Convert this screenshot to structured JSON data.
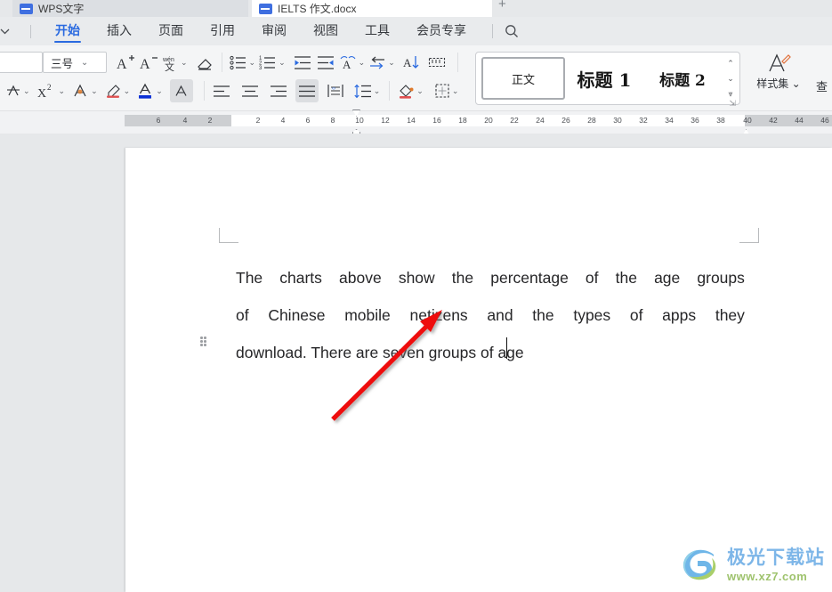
{
  "window": {
    "tabs": [
      {
        "label": "WPS文字",
        "active": false,
        "icon": "document-icon"
      },
      {
        "label": "IELTS 作文.docx",
        "active": true,
        "icon": "document-icon"
      }
    ],
    "new_tab_label": "+"
  },
  "ribbon": {
    "collapse_icon": "chevron-down-icon",
    "tabs": [
      {
        "label": "开始",
        "active": true
      },
      {
        "label": "插入",
        "active": false
      },
      {
        "label": "页面",
        "active": false
      },
      {
        "label": "引用",
        "active": false
      },
      {
        "label": "审阅",
        "active": false
      },
      {
        "label": "视图",
        "active": false
      },
      {
        "label": "工具",
        "active": false
      },
      {
        "label": "会员专享",
        "active": false
      }
    ],
    "search_icon": "search-icon"
  },
  "toolbar": {
    "font_name": "",
    "font_size": "三号",
    "row1": [
      {
        "name": "increase-font-size-button",
        "icon": "A+"
      },
      {
        "name": "decrease-font-size-button",
        "icon": "A-"
      },
      {
        "name": "pinyin-guide-button",
        "icon": "wen"
      },
      {
        "name": "clear-formatting-button",
        "icon": "eraser"
      },
      {
        "name": "bullet-list-button",
        "icon": "bullets"
      },
      {
        "name": "numbered-list-button",
        "icon": "numbering"
      },
      {
        "name": "decrease-indent-button",
        "icon": "outdent"
      },
      {
        "name": "increase-indent-button",
        "icon": "indent"
      },
      {
        "name": "character-border-button",
        "icon": "char-scale"
      },
      {
        "name": "text-direction-button",
        "icon": "text-direction"
      },
      {
        "name": "sort-button",
        "icon": "sort-az"
      },
      {
        "name": "show-marks-button",
        "icon": "paragraph-marks"
      }
    ],
    "row2": [
      {
        "name": "character-shading-button",
        "icon": "char-shading"
      },
      {
        "name": "superscript-button",
        "icon": "X2"
      },
      {
        "name": "font-color-button",
        "icon": "font-color"
      },
      {
        "name": "highlight-button",
        "icon": "highlighter"
      },
      {
        "name": "text-effect-button",
        "icon": "text-effect"
      },
      {
        "name": "text-box-button",
        "icon": "text-frame"
      },
      {
        "name": "align-left-button",
        "icon": "align-left"
      },
      {
        "name": "align-center-button",
        "icon": "align-center"
      },
      {
        "name": "align-right-button",
        "icon": "align-right"
      },
      {
        "name": "align-justify-button",
        "icon": "align-justify",
        "active": true
      },
      {
        "name": "distribute-button",
        "icon": "distribute"
      },
      {
        "name": "line-spacing-button",
        "icon": "line-spacing"
      },
      {
        "name": "shading-button",
        "icon": "paint-bucket"
      },
      {
        "name": "borders-button",
        "icon": "borders"
      }
    ],
    "styles": {
      "items": [
        {
          "label": "正文",
          "selected": true
        },
        {
          "label": "标题 1",
          "selected": false
        },
        {
          "label": "标题 2",
          "selected": false
        }
      ],
      "scroll_up_icon": "chevron-up-icon",
      "scroll_down_icon": "chevron-down-icon",
      "scroll_more_icon": "chevron-expand-icon"
    },
    "style_set": {
      "label": "样式集",
      "icon": "style-set-icon"
    },
    "find_label": "查",
    "launcher_icon": "dialog-launcher-icon"
  },
  "ruler": {
    "left_ticks": [
      "6",
      "4",
      "2"
    ],
    "right_ticks": [
      "2",
      "4",
      "6",
      "8",
      "10",
      "12",
      "14",
      "16",
      "18",
      "20",
      "22",
      "24",
      "26",
      "28",
      "30",
      "32",
      "34",
      "36",
      "38",
      "40",
      "42",
      "44",
      "46"
    ],
    "indent_markers": [
      "first-line-indent",
      "hanging-indent",
      "left-indent",
      "right-indent"
    ]
  },
  "document": {
    "lines": [
      {
        "words": [
          "The",
          "charts",
          "above",
          "show",
          "the",
          "percentage",
          "of",
          "the",
          "age",
          "groups"
        ],
        "justified": true
      },
      {
        "words": [
          "of",
          "Chinese",
          "mobile",
          "netizens",
          "and",
          "the",
          "types",
          "of",
          "apps",
          "they"
        ],
        "justified": true
      },
      {
        "text": "download. There are seven groups of age",
        "justified": false
      }
    ],
    "full_text": "The charts above show the percentage of the age groups of Chinese mobile netizens and the types of apps they download. There are seven groups of age",
    "annotation": {
      "type": "red-arrow",
      "color": "#ee1111"
    },
    "caret": true,
    "paragraph_grip_icon": "drag-handle-icon"
  },
  "watermark": {
    "brand": "极光下载站",
    "url": "www.xz7.com",
    "logo_icon": "aurora-logo-icon"
  },
  "colors": {
    "accent": "#2a6ae0",
    "ribbon_bg": "#e9ebed",
    "toolbar_bg": "#f4f5f6",
    "canvas_bg": "#e6e8ea",
    "arrow_red": "#ee1111",
    "watermark_blue": "#7db6e8",
    "watermark_green": "#9fc36e"
  }
}
